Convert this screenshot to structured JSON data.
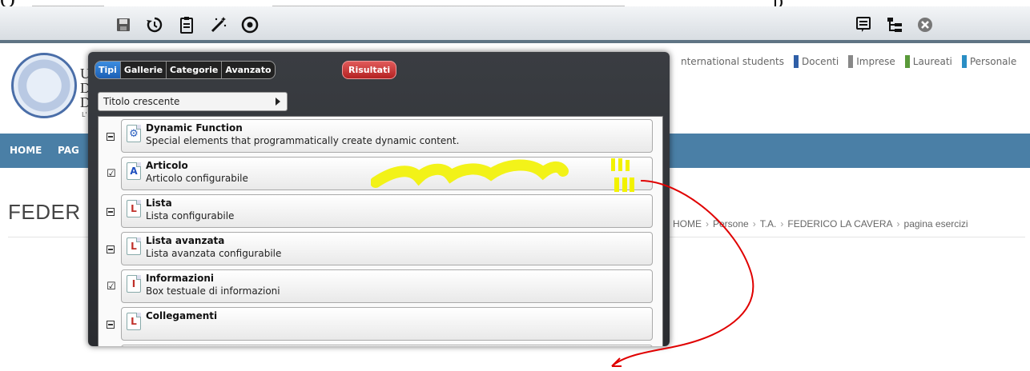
{
  "toolbar": {
    "left_icons": [
      "save-icon",
      "history-icon",
      "clipboard-icon",
      "magic-wand-icon",
      "target-icon"
    ],
    "right_icons": [
      "list-icon",
      "tree-icon",
      "close-icon"
    ]
  },
  "header": {
    "university_lines": [
      "U",
      "D",
      "D"
    ],
    "small_text": "L'"
  },
  "top_nav": [
    {
      "label": "nternational students",
      "color": "#ffffff"
    },
    {
      "label": "Docenti",
      "color": "#2f5fa7"
    },
    {
      "label": "Imprese",
      "color": "#888888"
    },
    {
      "label": "Laureati",
      "color": "#5a9a3a"
    },
    {
      "label": "Personale",
      "color": "#2a8ec4"
    }
  ],
  "nav": {
    "home": "HOME",
    "pag": "PAG"
  },
  "page": {
    "title": "FEDER"
  },
  "breadcrumb": [
    "HOME",
    "Persone",
    "T.A.",
    "FEDERICO LA CAVERA",
    "pagina esercizi"
  ],
  "dialog": {
    "tabs": [
      "Tipi",
      "Gallerie",
      "Categorie",
      "Avanzato"
    ],
    "active_tab": "Tipi",
    "results_button": "Risultati",
    "sort_value": "Titolo crescente",
    "items": [
      {
        "title": "Dynamic Function",
        "description": "Special elements that programmatically create dynamic content.",
        "checked": false,
        "icon": "gear-icon",
        "icon_char": "⚙",
        "icon_color": "#2b5fbf"
      },
      {
        "title": "Articolo",
        "description": "Articolo configurabile",
        "checked": true,
        "icon": "article-icon",
        "icon_char": "A",
        "icon_color": "#1f4fbf"
      },
      {
        "title": "Lista",
        "description": "Lista configurabile",
        "checked": false,
        "icon": "list-doc-icon",
        "icon_char": "L",
        "icon_color": "#c0302a"
      },
      {
        "title": "Lista avanzata",
        "description": "Lista avanzata configurabile",
        "checked": false,
        "icon": "list-doc-icon",
        "icon_char": "L",
        "icon_color": "#c0302a"
      },
      {
        "title": "Informazioni",
        "description": "Box testuale di informazioni",
        "checked": true,
        "icon": "info-doc-icon",
        "icon_char": "I",
        "icon_color": "#c0302a"
      },
      {
        "title": "Collegamenti",
        "description": "",
        "checked": false,
        "icon": "link-doc-icon",
        "icon_char": "L",
        "icon_color": "#c0302a"
      }
    ]
  },
  "colors": {
    "navbar": "#4a7fa6",
    "dialog_bg": "#2f3236",
    "tab_active": "#2a74cf",
    "results_button": "#c83232",
    "highlight": "#f0f000",
    "annotation_arrow": "#e00000"
  }
}
